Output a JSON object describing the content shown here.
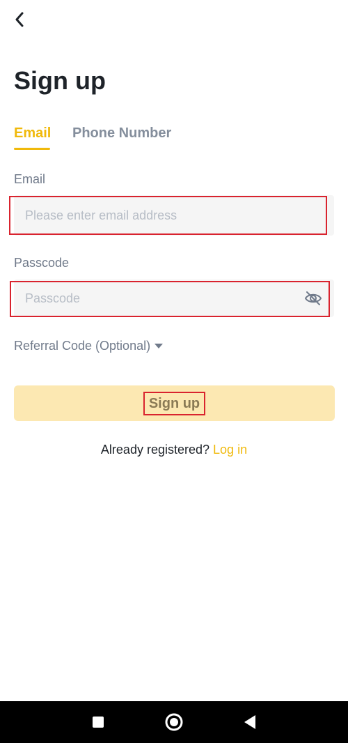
{
  "header": {
    "back_icon": "chevron-left-icon",
    "title": "Sign up"
  },
  "tabs": [
    {
      "label": "Email",
      "active": true
    },
    {
      "label": "Phone Number",
      "active": false
    }
  ],
  "email_field": {
    "label": "Email",
    "placeholder": "Please enter email address",
    "value": ""
  },
  "passcode_field": {
    "label": "Passcode",
    "placeholder": "Passcode",
    "value": "",
    "visibility_icon": "eye-off-icon"
  },
  "referral": {
    "label": "Referral Code (Optional)",
    "icon": "caret-down-icon"
  },
  "signup_button": {
    "label": "Sign up"
  },
  "login_prompt": {
    "text": "Already registered?",
    "link": "Log in"
  },
  "system_nav": {
    "recents_icon": "square-icon",
    "home_icon": "circle-icon",
    "back_icon": "triangle-back-icon"
  },
  "colors": {
    "accent": "#f0b90b",
    "button_bg": "#fce8b2",
    "highlight": "#d9232e",
    "field_bg": "#f5f5f5"
  }
}
